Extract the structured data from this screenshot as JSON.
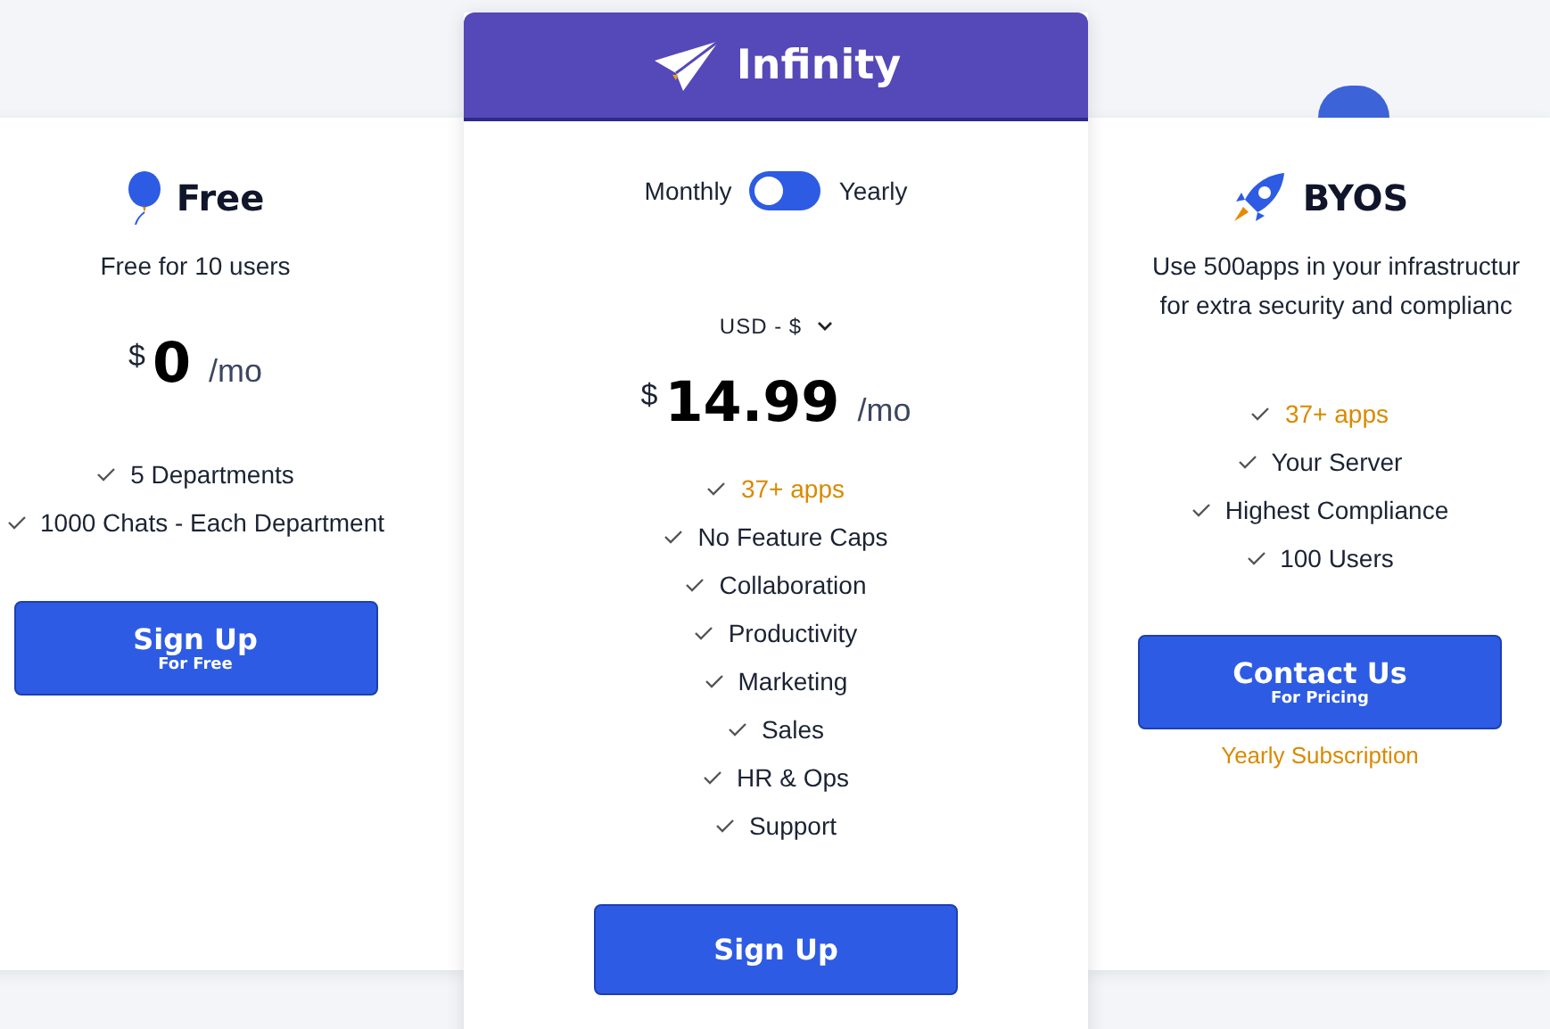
{
  "plans": [
    {
      "kind": "side",
      "name": "Free",
      "description": [
        "Free for 10 users"
      ],
      "currency": "$",
      "price": "0",
      "period": "/mo",
      "features": [
        {
          "text": "5 Departments",
          "highlight": false
        },
        {
          "text": "1000 Chats - Each Department",
          "highlight": false
        }
      ],
      "button": {
        "label": "Sign Up",
        "sublabel": "For Free"
      }
    },
    {
      "kind": "featured",
      "name": "Infinity",
      "billing": {
        "left": "Monthly",
        "right": "Yearly",
        "on": false
      },
      "currency_select": "USD - $",
      "currency": "$",
      "price": "14.99",
      "period": "/mo",
      "features": [
        {
          "text": "37+ apps",
          "highlight": true
        },
        {
          "text": "No Feature Caps",
          "highlight": false
        },
        {
          "text": "Collaboration",
          "highlight": false
        },
        {
          "text": "Productivity",
          "highlight": false
        },
        {
          "text": "Marketing",
          "highlight": false
        },
        {
          "text": "Sales",
          "highlight": false
        },
        {
          "text": "HR & Ops",
          "highlight": false
        },
        {
          "text": "Support",
          "highlight": false
        }
      ],
      "button": {
        "label": "Sign Up"
      }
    },
    {
      "kind": "side",
      "name": "BYOS",
      "description": [
        "Use 500apps in your infrastructur",
        "for extra security and complianc"
      ],
      "features": [
        {
          "text": "37+ apps",
          "highlight": true
        },
        {
          "text": "Your Server",
          "highlight": false
        },
        {
          "text": "Highest Compliance",
          "highlight": false
        },
        {
          "text": "100 Users",
          "highlight": false
        }
      ],
      "button": {
        "label": "Contact Us",
        "sublabel": "For Pricing"
      },
      "note": "Yearly Subscription"
    }
  ]
}
